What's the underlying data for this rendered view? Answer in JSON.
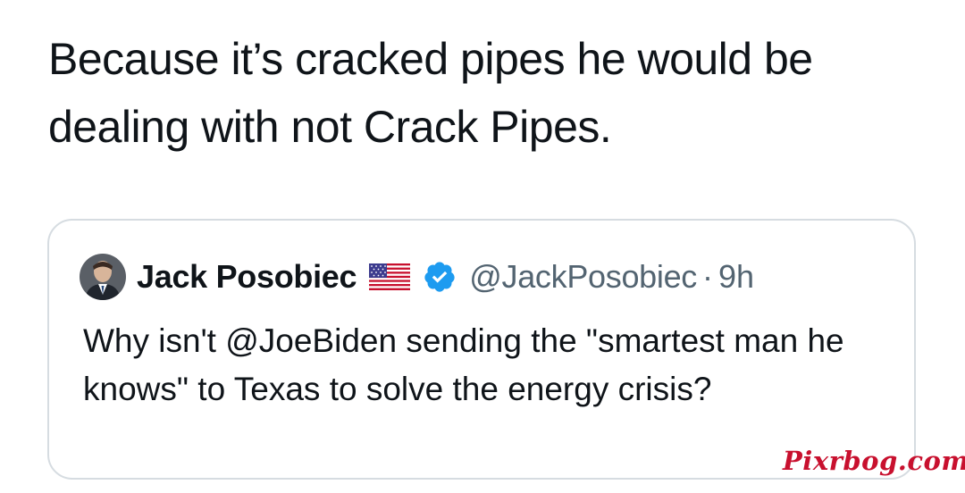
{
  "tweet": {
    "text": "Because it’s cracked pipes he would be dealing with not Crack Pipes."
  },
  "quoted_tweet": {
    "author_name": "Jack Posobiec",
    "handle": "@JackPosobiec",
    "separator": "·",
    "time": "9h",
    "flag_icon": "us-flag-icon",
    "verified_icon": "verified-badge-icon",
    "text": "Why isn't @JoeBiden sending the \"smartest man he knows\" to Texas to solve the energy crisis?"
  },
  "watermark": {
    "text": "Pixrbog.com"
  },
  "colors": {
    "text_primary": "#0f1419",
    "text_secondary": "#536471",
    "border": "#d6dce1",
    "verified_blue": "#1d9bf0",
    "watermark_red": "#c8102e"
  }
}
